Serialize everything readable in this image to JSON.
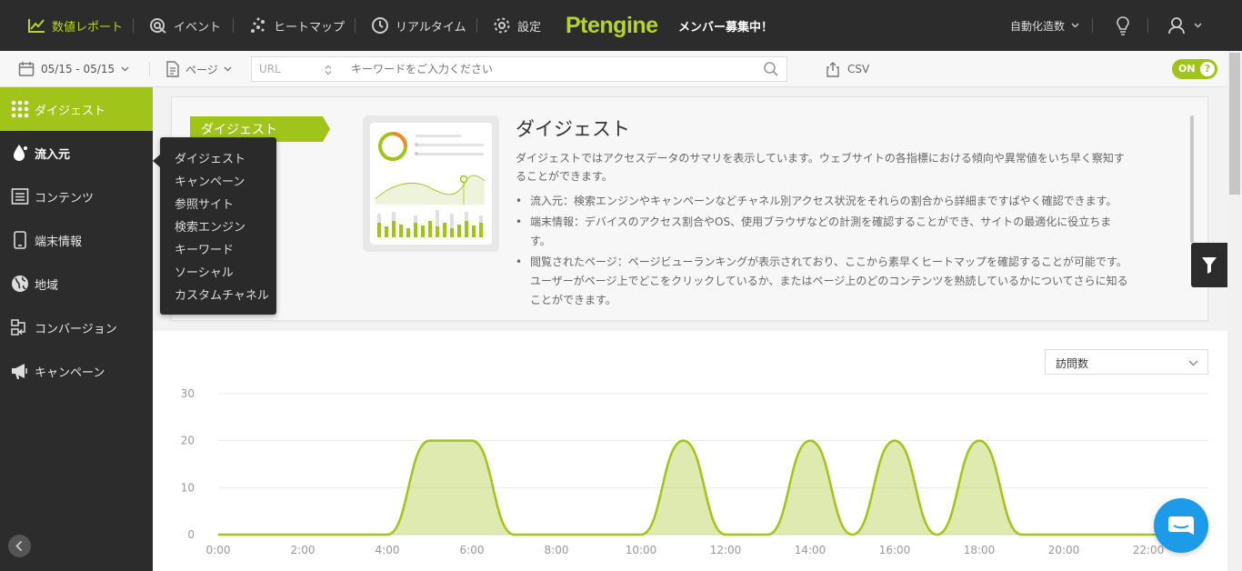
{
  "topnav": {
    "report": "数値レポート",
    "event": "イベント",
    "heatmap": "ヒートマップ",
    "realtime": "リアルタイム",
    "settings": "設定",
    "logo": "Ptengine",
    "recruit": "メンバー募集中！",
    "automation": "自動化造数"
  },
  "toolbar": {
    "date_range": "05/15 - 05/15",
    "page_select": "ページ",
    "url_select": "URL",
    "keyword_placeholder": "キーワードをご入力ください",
    "csv": "CSV",
    "toggle": "ON",
    "help": "?"
  },
  "sidebar": [
    {
      "label": "ダイジェスト",
      "icon": "grid-icon"
    },
    {
      "label": "流入元",
      "icon": "drop-icon"
    },
    {
      "label": "コンテンツ",
      "icon": "content-icon"
    },
    {
      "label": "端末情報",
      "icon": "device-icon"
    },
    {
      "label": "地域",
      "icon": "globe-icon"
    },
    {
      "label": "コンバージョン",
      "icon": "conversion-icon"
    },
    {
      "label": "キャンペーン",
      "icon": "megaphone-icon"
    }
  ],
  "flyout": [
    "ダイジェスト",
    "キャンペーン",
    "参照サイト",
    "検索エンジン",
    "キーワード",
    "ソーシャル",
    "カスタムチャネル"
  ],
  "intro": {
    "tag": "ダイジェスト",
    "title": "ダイジェスト",
    "desc_lines": [
      "ダイジェストではアクセスデータのサマリを表示しています。ウェブサイトの各指標における傾向や異常値をいち早く察知す",
      "ることができます。"
    ],
    "bullets": [
      [
        "流入元：検索エンジンやキャンペーンなどチャネル別アクセス状況をそれらの割合から詳細まですばやく確認できます。"
      ],
      [
        "端末情報：デバイスのアクセス割合やOS、使用ブラウザなどの計測を確認することができ、サイトの最適化に役立ちま",
        "す。"
      ],
      [
        "閲覧されたページ：ページビューランキングが表示されており、ここから素早くヒートマップを確認することが可能です。",
        "ユーザーがページ上でどこをクリックしているか、またはページ上のどのコンテンツを熟読しているかについてさらに知る",
        "ことができます。"
      ]
    ]
  },
  "metric_select": "訪問数",
  "colors": {
    "accent": "#a0c419",
    "sidebar": "#2c2c2c",
    "chat": "#1e9be8"
  },
  "chart_data": {
    "type": "area",
    "title": "",
    "xlabel": "",
    "ylabel": "",
    "x_ticks": [
      "0:00",
      "2:00",
      "4:00",
      "6:00",
      "8:00",
      "10:00",
      "12:00",
      "14:00",
      "16:00",
      "18:00",
      "20:00",
      "22:00"
    ],
    "y_ticks": [
      0,
      10,
      20,
      30
    ],
    "ylim": [
      0,
      30
    ],
    "x_hours": [
      0,
      1,
      2,
      3,
      4,
      5,
      6,
      7,
      8,
      9,
      10,
      11,
      12,
      13,
      14,
      15,
      16,
      17,
      18,
      19,
      20,
      21,
      22,
      23
    ],
    "series": [
      {
        "values": [
          0,
          0,
          0,
          0,
          0,
          20,
          20,
          0,
          0,
          0,
          0,
          20,
          0,
          0,
          20,
          0,
          20,
          0,
          20,
          0,
          0,
          0,
          0,
          0
        ]
      }
    ]
  }
}
